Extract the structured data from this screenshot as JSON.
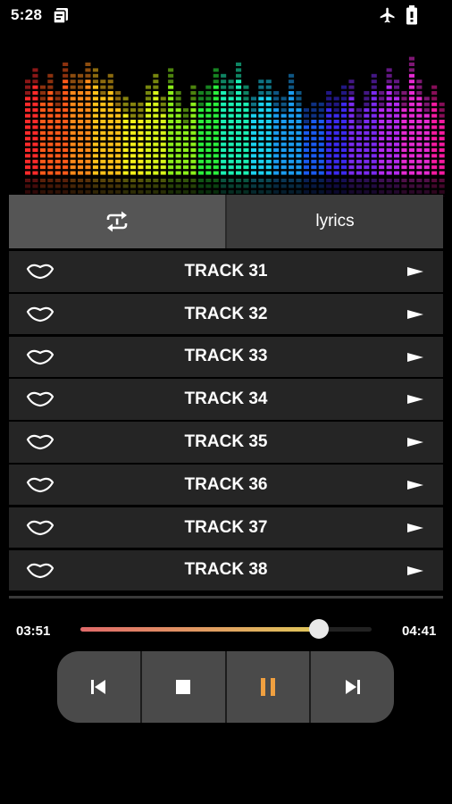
{
  "status_bar": {
    "time": "5:28",
    "icons": [
      "clipboard-icon",
      "airplane-icon",
      "battery-icon"
    ]
  },
  "visualizer": {
    "levels": [
      0.78,
      0.88,
      0.74,
      0.82,
      0.7,
      0.92,
      0.8,
      0.84,
      0.9,
      0.86,
      0.79,
      0.82,
      0.7,
      0.66,
      0.62,
      0.58,
      0.74,
      0.82,
      0.66,
      0.86,
      0.7,
      0.56,
      0.74,
      0.7,
      0.72,
      0.88,
      0.82,
      0.78,
      0.92,
      0.74,
      0.64,
      0.76,
      0.78,
      0.7,
      0.66,
      0.8,
      0.68,
      0.54,
      0.6,
      0.58,
      0.7,
      0.64,
      0.74,
      0.78,
      0.56,
      0.68,
      0.84,
      0.7,
      0.86,
      0.78,
      0.7,
      0.94,
      0.78,
      0.64,
      0.72,
      0.58
    ],
    "colors": [
      "#ff2a2a",
      "#ff5a1a",
      "#ff8a1a",
      "#ffc21a",
      "#f5f01a",
      "#d8f51a",
      "#8cf01a",
      "#2af03c",
      "#1af0b4",
      "#1ad2f0",
      "#1a9cf0",
      "#1a5af0",
      "#3c2af0",
      "#7a2af0",
      "#b42af0",
      "#e62ad2",
      "#f51aa0"
    ]
  },
  "tabs": {
    "repeat_icon": "repeat-one-icon",
    "lyrics_label": "lyrics"
  },
  "tracks": [
    {
      "title": "TRACK 31"
    },
    {
      "title": "TRACK 32"
    },
    {
      "title": "TRACK 33"
    },
    {
      "title": "TRACK 34"
    },
    {
      "title": "TRACK 35"
    },
    {
      "title": "TRACK 36"
    },
    {
      "title": "TRACK 37"
    },
    {
      "title": "TRACK 38"
    }
  ],
  "player": {
    "current_time": "03:51",
    "total_time": "04:41",
    "progress": 0.82,
    "colors": {
      "fill_start": "#e06a6a",
      "fill_end": "#e0c85a",
      "pause_accent": "#f0a040"
    },
    "buttons": [
      "previous-icon",
      "stop-icon",
      "pause-icon",
      "next-icon"
    ]
  }
}
